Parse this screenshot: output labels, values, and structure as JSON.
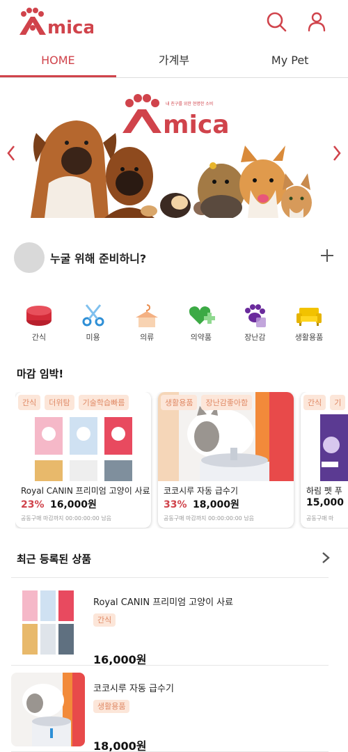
{
  "header": {
    "logo_text": "mica",
    "search_icon": "search-icon",
    "profile_icon": "user-icon",
    "brand_color": "#d0434b"
  },
  "tabs": [
    {
      "label": "HOME",
      "active": true
    },
    {
      "label": "가계부",
      "active": false
    },
    {
      "label": "My Pet",
      "active": false
    }
  ],
  "banner": {
    "logo_text": "mica",
    "tagline": "내 친구를 위한 현명한 소비",
    "prev_icon": "chevron-left-icon",
    "next_icon": "chevron-right-icon"
  },
  "who": {
    "text": "누굴 위해 준비하니?",
    "add_icon": "plus-icon"
  },
  "categories": [
    {
      "label": "간식",
      "icon": "can-icon"
    },
    {
      "label": "미용",
      "icon": "scissors-icon"
    },
    {
      "label": "의류",
      "icon": "hanger-icon"
    },
    {
      "label": "의약품",
      "icon": "heart-cross-icon"
    },
    {
      "label": "장난감",
      "icon": "paw-icon"
    },
    {
      "label": "생활용품",
      "icon": "sofa-icon"
    }
  ],
  "deals_section": {
    "title": "마감 임박!",
    "items": [
      {
        "tags": [
          "간식",
          "더위탐",
          "기술학습빠름"
        ],
        "title": "Royal CANIN 프리미엄 고양이 사료",
        "discount": "23%",
        "price": "16,000원",
        "deadline": "공동구매 마감까지 00:00:00:00 남음"
      },
      {
        "tags": [
          "생활용품",
          "장난감좋아함"
        ],
        "title": "코코시루 자동 급수기",
        "discount": "33%",
        "price": "18,000원",
        "deadline": "공동구매 마감까지 00:00:00:00 남음"
      },
      {
        "tags": [
          "간식",
          "기"
        ],
        "title": "하림 펫 푸",
        "discount": "",
        "price": "15,000",
        "deadline": "공동구매 마"
      }
    ]
  },
  "recent_section": {
    "title": "최근 등록된 상품",
    "more_icon": "chevron-right-icon",
    "items": [
      {
        "title": "Royal CANIN 프리미엄 고양이 사료",
        "tag": "간식",
        "price": "16,000원"
      },
      {
        "title": "코코시루 자동 급수기",
        "tag": "생활용품",
        "price": "18,000원"
      }
    ]
  }
}
